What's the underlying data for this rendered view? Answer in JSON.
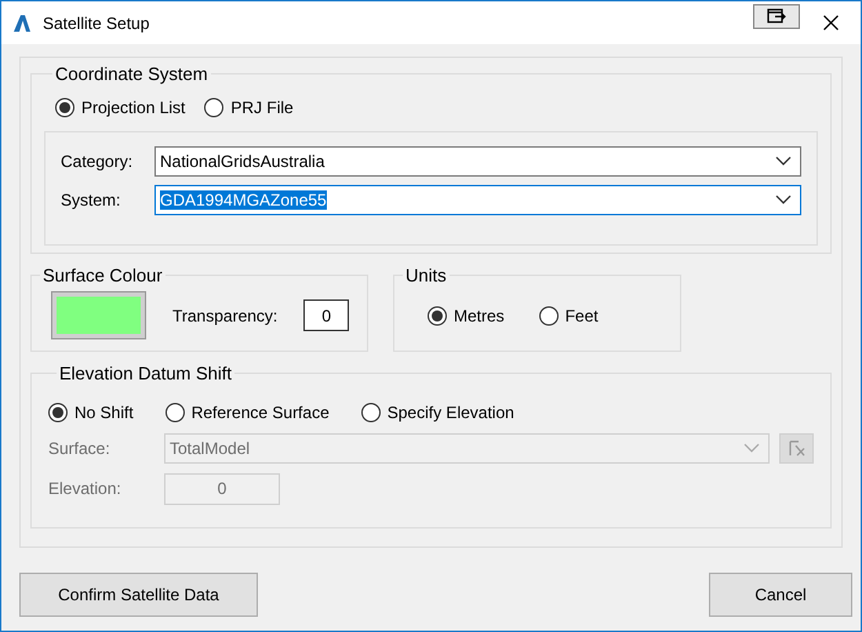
{
  "window": {
    "title": "Satellite Setup"
  },
  "coordinate_system": {
    "title": "Coordinate System",
    "source_options": [
      {
        "label": "Projection List",
        "selected": true
      },
      {
        "label": "PRJ File",
        "selected": false
      }
    ],
    "fields": [
      {
        "label": "Category:",
        "value": "NationalGridsAustralia",
        "focused": false
      },
      {
        "label": "System:",
        "value": "GDA1994MGAZone55",
        "focused": true
      }
    ]
  },
  "surface_colour": {
    "title": "Surface Colour",
    "color": "#80ff80",
    "transparency_label": "Transparency:",
    "transparency": "0"
  },
  "units": {
    "title": "Units",
    "options": [
      {
        "label": "Metres",
        "selected": true
      },
      {
        "label": "Feet",
        "selected": false
      }
    ]
  },
  "elevation_datum_shift": {
    "title": "Elevation Datum Shift",
    "options": [
      {
        "label": "No Shift",
        "selected": true
      },
      {
        "label": "Reference Surface",
        "selected": false
      },
      {
        "label": "Specify Elevation",
        "selected": false
      }
    ],
    "surface": {
      "label": "Surface:",
      "value": "TotalModel",
      "disabled": true
    },
    "elevation": {
      "label": "Elevation:",
      "value": "0",
      "disabled": true
    }
  },
  "buttons": [
    {
      "label": "Confirm Satellite Data"
    },
    {
      "label": "Cancel"
    }
  ]
}
